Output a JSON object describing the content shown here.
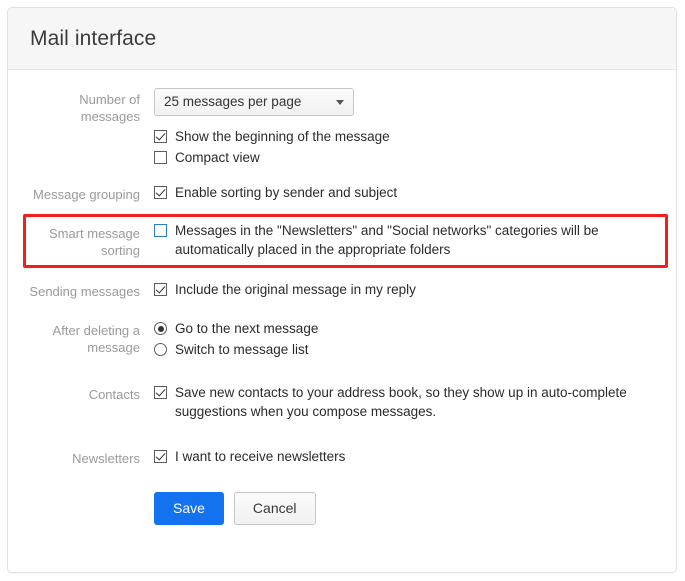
{
  "panel": {
    "title": "Mail interface"
  },
  "rows": {
    "number_of_messages": {
      "label": "Number of messages",
      "select_value": "25 messages per page",
      "options": [
        "25 messages per page"
      ],
      "checkbox_show_beginning": {
        "label": "Show the beginning of the message",
        "checked": true
      },
      "checkbox_compact_view": {
        "label": "Compact view",
        "checked": false
      }
    },
    "message_grouping": {
      "label": "Message grouping",
      "checkbox": {
        "label": "Enable sorting by sender and subject",
        "checked": true
      }
    },
    "smart_message_sorting": {
      "label": "Smart message sorting",
      "checkbox": {
        "label": "Messages in the \"Newsletters\" and \"Social networks\" categories will be automatically placed in the appropriate folders",
        "checked": false
      },
      "highlight_color": "#f41d1d"
    },
    "sending_messages": {
      "label": "Sending messages",
      "checkbox": {
        "label": "Include the original message in my reply",
        "checked": true
      }
    },
    "after_deleting": {
      "label": "After deleting a message",
      "radio_next": {
        "label": "Go to the next message",
        "selected": true
      },
      "radio_list": {
        "label": "Switch to message list",
        "selected": false
      }
    },
    "contacts": {
      "label": "Contacts",
      "checkbox": {
        "label": "Save new contacts to your address book, so they show up in auto-complete suggestions when you compose messages.",
        "checked": true
      }
    },
    "newsletters": {
      "label": "Newsletters",
      "checkbox": {
        "label": "I want to receive newsletters",
        "checked": true
      }
    }
  },
  "buttons": {
    "save": "Save",
    "cancel": "Cancel",
    "save_color": "#1272f0"
  }
}
